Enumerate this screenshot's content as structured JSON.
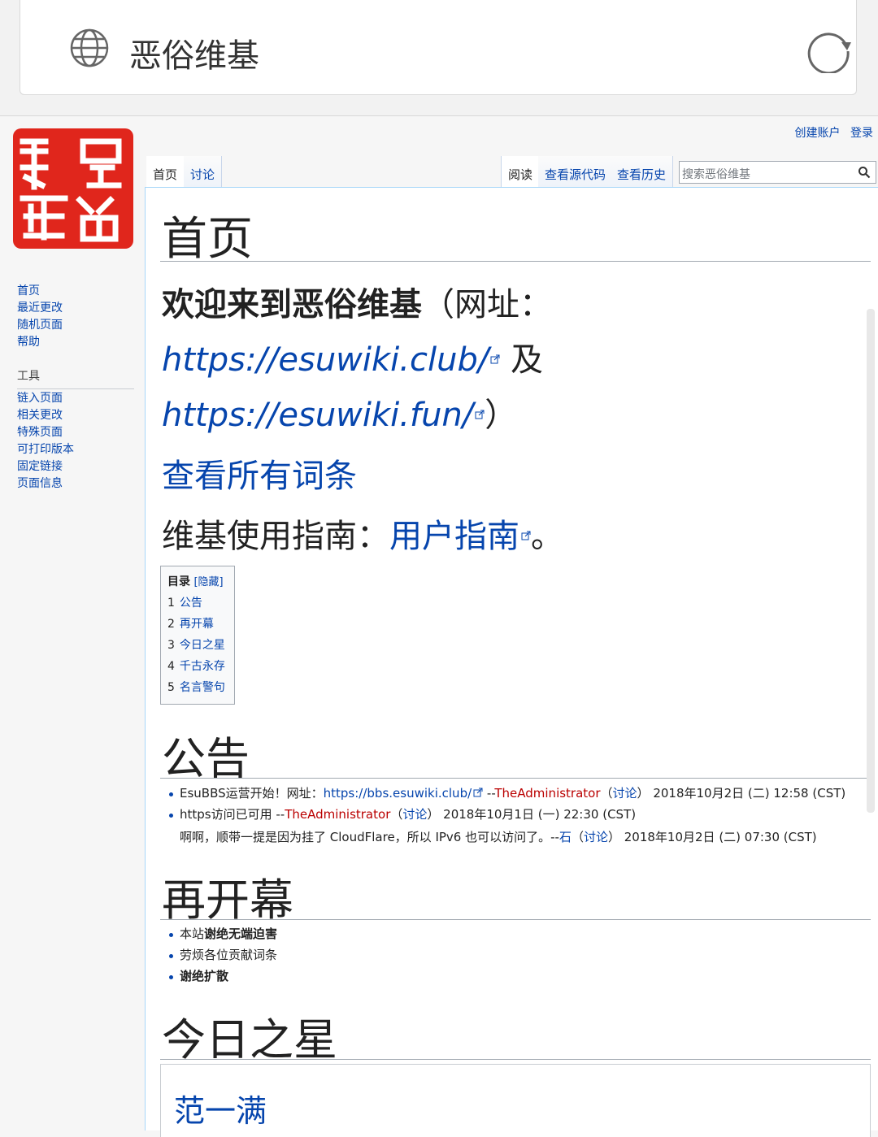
{
  "browser": {
    "site_title": "恶俗维基"
  },
  "personal": {
    "create_account": "创建账户",
    "login": "登录"
  },
  "tabs": {
    "main": "首页",
    "talk": "讨论",
    "read": "阅读",
    "view_source": "查看源代码",
    "history": "查看历史"
  },
  "search": {
    "placeholder": "搜索恶俗维基"
  },
  "sidebar": {
    "nav": [
      "首页",
      "最近更改",
      "随机页面",
      "帮助"
    ],
    "tools_heading": "工具",
    "tools": [
      "链入页面",
      "相关更改",
      "特殊页面",
      "可打印版本",
      "固定链接",
      "页面信息"
    ]
  },
  "page": {
    "title": "首页",
    "welcome_bold": "欢迎来到恶俗维基",
    "welcome_open": "（网址：",
    "url1": "https://esuwiki.club/",
    "and": "及",
    "url2": "https://esuwiki.fun/",
    "close": "）",
    "all_entries": "查看所有词条",
    "guide_prefix": "维基使用指南：",
    "guide_link": "用户指南",
    "guide_suffix": "。"
  },
  "toc": {
    "title": "目录",
    "hide": "[隐藏]",
    "items": [
      {
        "num": "1",
        "label": "公告"
      },
      {
        "num": "2",
        "label": "再开幕"
      },
      {
        "num": "3",
        "label": "今日之星"
      },
      {
        "num": "4",
        "label": "千古永存"
      },
      {
        "num": "5",
        "label": "名言警句"
      }
    ]
  },
  "announce": {
    "heading": "公告",
    "l1_text": "EsuBBS运营开始！网址：",
    "l1_link": "https://bbs.esuwiki.club/",
    "l1_sep": " --",
    "l1_user": "TheAdministrator",
    "l1_talk": "讨论",
    "l1_time": "2018年10月2日 (二) 12:58 (CST)",
    "l2_text": "https访问已可用 --",
    "l2_user": "TheAdministrator",
    "l2_talk": "讨论",
    "l2_time": "2018年10月1日 (一) 22:30 (CST)",
    "l3_text": "啊啊，顺带一提是因为挂了 CloudFlare，所以 IPv6 也可以访问了。--",
    "l3_user": "石",
    "l3_talk": "讨论",
    "l3_time": "2018年10月2日 (二) 07:30 (CST)"
  },
  "reopen": {
    "heading": "再开幕",
    "i1_pre": "本站",
    "i1_bold": "谢绝无端迫害",
    "i2": "劳烦各位贡献词条",
    "i3": "谢绝扩散"
  },
  "star": {
    "heading": "今日之星",
    "name": "范一满"
  },
  "colors": {
    "link": "#0645ad",
    "redlink": "#ba0000",
    "logo_red": "#e0261c"
  }
}
